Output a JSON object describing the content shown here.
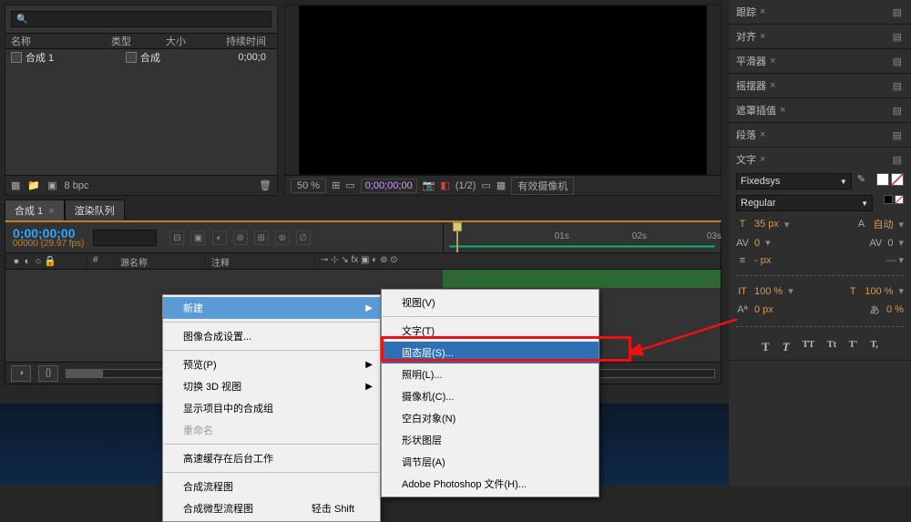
{
  "project": {
    "search_placeholder": "",
    "cols": {
      "name": "名称",
      "type": "类型",
      "size": "大小",
      "dur": "持续时间"
    },
    "rows": [
      {
        "name": "合成 1",
        "type": "合成",
        "dur": "0;00;0"
      }
    ],
    "footer": {
      "bpc": "8 bpc"
    }
  },
  "viewer": {
    "zoom": "50 %",
    "timecode": "0;00;00;00",
    "ratio": "(1/2)",
    "camera_dd": "有效摄像机"
  },
  "right_panels": {
    "tracker": "跟踪",
    "align": "对齐",
    "smoother": "平滑器",
    "wiggler": "摇摆器",
    "mask_interp": "遮罩插值",
    "paragraph": "段落",
    "character": "文字"
  },
  "character": {
    "font": "Fixedsys",
    "style": "Regular",
    "size_label": "T",
    "size": "35 px",
    "leading_label": "A",
    "leading": "自动",
    "kerning_label": "AV",
    "kerning": "0",
    "tracking_label": "AV",
    "tracking": "0",
    "stroke_label": "≡",
    "stroke": "- px",
    "vscale_label": "IT",
    "vscale": "100 %",
    "hscale_label": "T",
    "hscale": "100 %",
    "baseline_label": "Aª",
    "baseline": "0 px",
    "tsume_label": "あ",
    "tsume": "0 %",
    "faux": [
      "T",
      "T",
      "TT",
      "Tt",
      "T'",
      "T,"
    ]
  },
  "timeline": {
    "tabs": [
      {
        "label": "合成 1",
        "active": true
      },
      {
        "label": "渲染队列",
        "active": false
      }
    ],
    "current_time": "0;00;00;00",
    "fps": "00000 (29.97 fps)",
    "cols": {
      "source": "源名称",
      "comment": "注释"
    },
    "ruler_ticks": [
      "01s",
      "02s",
      "03s"
    ]
  },
  "context_menu_1": [
    {
      "label": "新建",
      "hi": true,
      "arrow": true
    },
    {
      "sep": true
    },
    {
      "label": "图像合成设置..."
    },
    {
      "sep": true
    },
    {
      "label": "预览(P)",
      "arrow": true
    },
    {
      "label": "切换 3D 视图",
      "arrow": true
    },
    {
      "label": "显示项目中的合成组"
    },
    {
      "label": "重命名",
      "disabled": true
    },
    {
      "sep": true
    },
    {
      "label": "高速缓存在后台工作"
    },
    {
      "sep": true
    },
    {
      "label": "合成流程图"
    },
    {
      "label": "合成微型流程图",
      "shortcut": "轻击 Shift"
    }
  ],
  "context_menu_2": [
    {
      "label": "视图(V)"
    },
    {
      "sep": true
    },
    {
      "label": "文字(T)"
    },
    {
      "label": "固态层(S)...",
      "hi_strong": true
    },
    {
      "label": "照明(L)..."
    },
    {
      "label": "摄像机(C)..."
    },
    {
      "label": "空白对象(N)"
    },
    {
      "label": "形状图层"
    },
    {
      "label": "调节层(A)"
    },
    {
      "label": "Adobe Photoshop 文件(H)..."
    }
  ]
}
